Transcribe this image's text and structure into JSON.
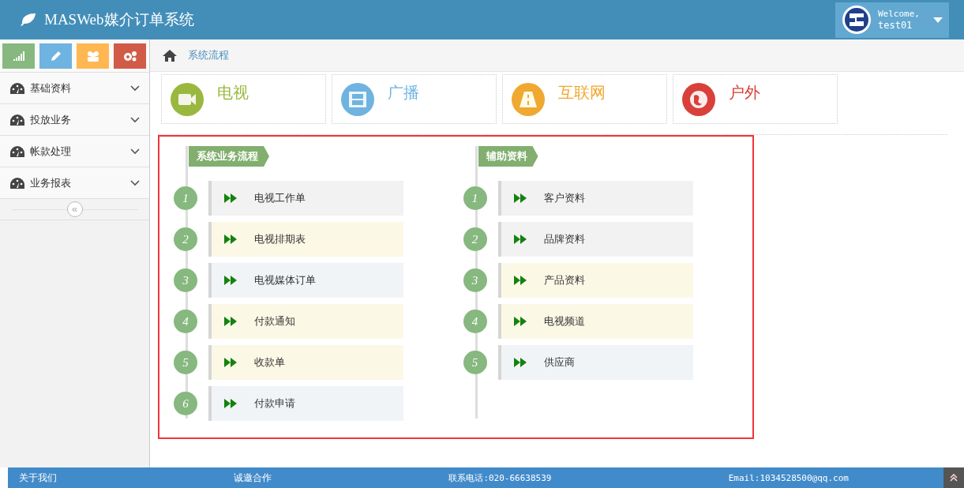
{
  "header": {
    "title": "MASWeb媒介订单系统",
    "user": {
      "greeting": "Welcome,",
      "name": "test01"
    }
  },
  "shortcuts": [
    {
      "kind": "chart",
      "color": "#87b87f"
    },
    {
      "kind": "pencil",
      "color": "#6fb3e0"
    },
    {
      "kind": "users",
      "color": "#ffb752"
    },
    {
      "kind": "gears",
      "color": "#d15b47"
    }
  ],
  "sidebar": {
    "items": [
      {
        "label": "基础资料",
        "expanded": false
      },
      {
        "label": "投放业务",
        "expanded": false
      },
      {
        "label": "帐款处理",
        "expanded": false
      },
      {
        "label": "业务报表",
        "expanded": false
      }
    ],
    "collapse": "«"
  },
  "breadcrumb": "系统流程",
  "categories": [
    {
      "label": "电视",
      "kind": "video",
      "color": "#9ab83f"
    },
    {
      "label": "广播",
      "kind": "film",
      "color": "#6fb3e0"
    },
    {
      "label": "互联网",
      "kind": "road",
      "color": "#f0a830"
    },
    {
      "label": "户外",
      "kind": "globe",
      "color": "#d9403a"
    }
  ],
  "flows": [
    {
      "title": "系统业务流程",
      "steps": [
        {
          "number": "1",
          "label": "电视工作单",
          "color": "#f2f2f2"
        },
        {
          "number": "2",
          "label": "电视排期表",
          "color": "#fcf8e6"
        },
        {
          "number": "3",
          "label": "电视媒体订单",
          "color": "#f1f4f7"
        },
        {
          "number": "4",
          "label": "付款通知",
          "color": "#fcf8e6"
        },
        {
          "number": "5",
          "label": "收款单",
          "color": "#fcf8e6"
        },
        {
          "number": "6",
          "label": "付款申请",
          "color": "#f1f4f7"
        }
      ]
    },
    {
      "title": "辅助资料",
      "steps": [
        {
          "number": "1",
          "label": "客户资料",
          "color": "#f2f2f2"
        },
        {
          "number": "2",
          "label": "品牌资料",
          "color": "#f2f2f2"
        },
        {
          "number": "3",
          "label": "产品资料",
          "color": "#fcf8e6"
        },
        {
          "number": "4",
          "label": "电视频道",
          "color": "#fcf8e6"
        },
        {
          "number": "5",
          "label": "供应商",
          "color": "#f1f4f7"
        }
      ]
    }
  ],
  "footer": [
    "关于我们",
    "诚邀合作",
    "联系电话:020-66638539",
    "Email:1034528500@qq.com"
  ]
}
